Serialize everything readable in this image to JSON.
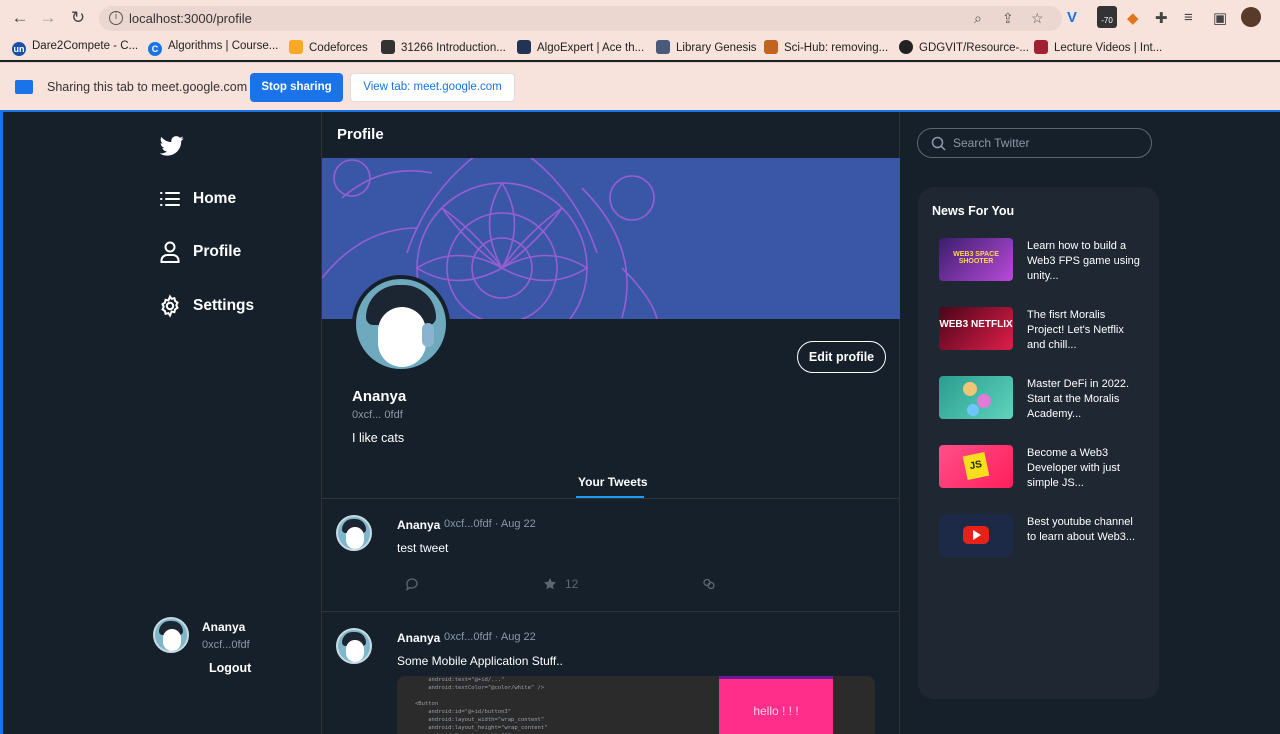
{
  "browser": {
    "url": "localhost:3000/profile",
    "bookmarks": [
      {
        "label": "Dare2Compete - C...",
        "icon": "un",
        "color": "#1c4fa8"
      },
      {
        "label": "Algorithms | Course...",
        "icon": "C",
        "color": "#1a73e8"
      },
      {
        "label": "Codeforces",
        "icon": "",
        "color": "#f9a825"
      },
      {
        "label": "31266 Introduction...",
        "icon": "",
        "color": "#333333"
      },
      {
        "label": "AlgoExpert | Ace th...",
        "icon": "",
        "color": "#223355"
      },
      {
        "label": "Library Genesis",
        "icon": "",
        "color": "#4a5a7a"
      },
      {
        "label": "Sci-Hub: removing...",
        "icon": "",
        "color": "#c0641e"
      },
      {
        "label": "GDGVIT/Resource-...",
        "icon": "",
        "color": "#222222"
      },
      {
        "label": "Lecture Videos | Int...",
        "icon": "",
        "color": "#a31f34"
      }
    ],
    "badge": "-70",
    "sharing_text": "Sharing this tab to meet.google.com",
    "stop_sharing": "Stop sharing",
    "view_tab": "View tab: meet.google.com"
  },
  "sidebar": {
    "items": [
      {
        "label": "Home",
        "icon": "home-list-icon"
      },
      {
        "label": "Profile",
        "icon": "user-icon"
      },
      {
        "label": "Settings",
        "icon": "gear-icon"
      }
    ],
    "user": {
      "name": "Ananya",
      "address": "0xcf...0fdf"
    },
    "logout": "Logout"
  },
  "main": {
    "title": "Profile",
    "profile": {
      "name": "Ananya",
      "address": "0xcf... 0fdf",
      "bio": "I like cats"
    },
    "edit_profile": "Edit profile",
    "tab": "Your Tweets",
    "tweets": [
      {
        "name": "Ananya",
        "meta": "0xcf...0fdf · Aug 22",
        "text": "test tweet",
        "stars": "12"
      },
      {
        "name": "Ananya",
        "meta": "0xcf...0fdf · Aug 22",
        "text": "Some Mobile Application Stuff..",
        "media_text": "hello ! ! !"
      }
    ]
  },
  "rail": {
    "search_placeholder": "Search Twitter",
    "news_title": "News For You",
    "news": [
      {
        "text": "Learn how to build a Web3 FPS game using unity...",
        "thumb": "WEB3 SPACE SHOOTER",
        "color": "#3b1d6e"
      },
      {
        "text": "The fisrt Moralis Project! Let's Netflix and chill...",
        "thumb": "WEB3 NETFLIX",
        "color": "#b3123a"
      },
      {
        "text": "Master DeFi in 2022. Start at the Moralis Academy...",
        "thumb": "",
        "color": "#3fb8a6"
      },
      {
        "text": "Become a Web3 Developer with just simple JS...",
        "thumb": "JS",
        "color": "#ff2e6b"
      },
      {
        "text": "Best youtube channel to learn about Web3...",
        "thumb": "",
        "color": "#1c2a48"
      }
    ]
  },
  "colors": {
    "bg": "#15202b",
    "accent": "#1d9bf0",
    "banner": "#3a57a7"
  }
}
